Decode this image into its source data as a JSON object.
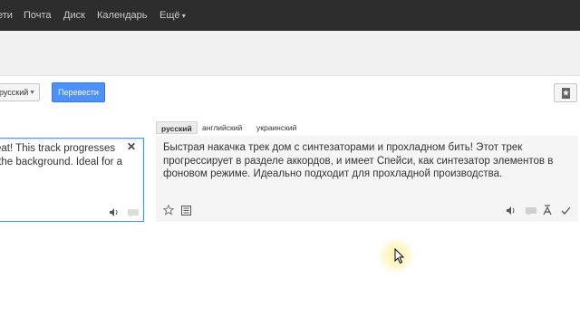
{
  "topnav": {
    "items": [
      "ети",
      "Почта",
      "Диск",
      "Календарь"
    ],
    "more_label": "Ещё"
  },
  "toolbar": {
    "source_lang": "русский",
    "translate_button": "Перевести"
  },
  "source": {
    "text": "eat! This track progresses\n the background. Ideal for a"
  },
  "target": {
    "tabs": [
      "русский",
      "английский",
      "украинский"
    ],
    "active_tab": "русский",
    "text": "Быстрая накачка трек дом с синтезаторами и прохладном бить! Этот трек прогрессирует в разделе аккордов, и имеет Спейси, как синтезатор элементов в фоновом режиме. Идеально подходит для прохладной производства."
  },
  "colors": {
    "topbar": "#2d2d2d",
    "accent": "#4d90fe",
    "panel": "#f5f5f5"
  },
  "icons": [
    "close-icon",
    "speaker-icon",
    "chat-icon",
    "star-icon",
    "document-icon",
    "pronunciation-icon",
    "check-icon",
    "bookmark-icon",
    "cursor-icon"
  ]
}
